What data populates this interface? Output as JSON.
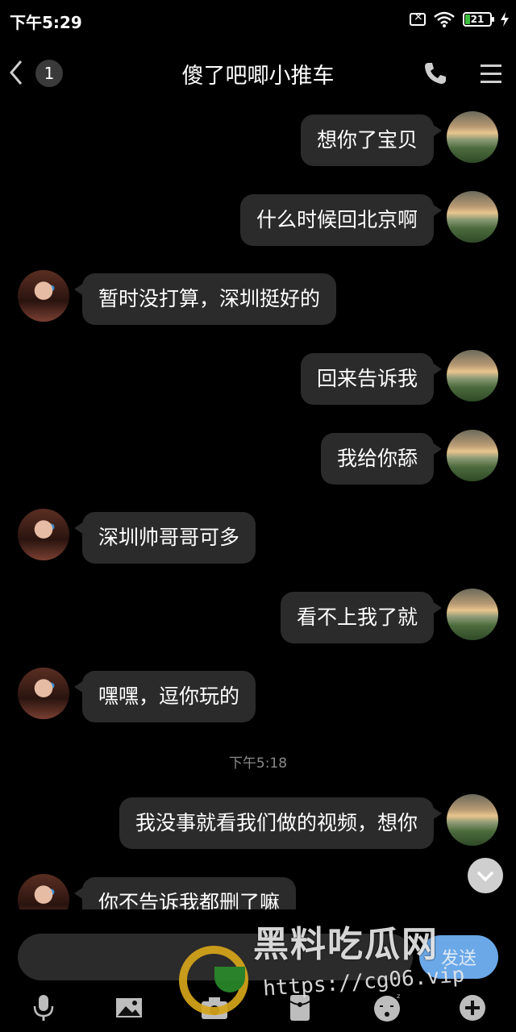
{
  "status_bar": {
    "time": "下午5:29",
    "battery": "21"
  },
  "header": {
    "unread_count": "1",
    "title": "傻了吧唧小推车"
  },
  "messages": [
    {
      "side": "me",
      "text": "想你了宝贝"
    },
    {
      "side": "me",
      "text": "什么时候回北京啊"
    },
    {
      "side": "other",
      "text": "暂时没打算，深圳挺好的"
    },
    {
      "side": "me",
      "text": "回来告诉我"
    },
    {
      "side": "me",
      "text": "我给你舔"
    },
    {
      "side": "other",
      "text": "深圳帅哥哥可多"
    },
    {
      "side": "me",
      "text": "看不上我了就"
    },
    {
      "side": "other",
      "text": "嘿嘿，逗你玩的"
    },
    {
      "timestamp": "下午5:18"
    },
    {
      "side": "me",
      "text": "我没事就看我们做的视频，想你"
    },
    {
      "side": "other",
      "text": "你不告诉我都删了嘛"
    }
  ],
  "input": {
    "placeholder": "",
    "send_label": "发送"
  },
  "toolbar": [
    "microphone-icon",
    "image-icon",
    "camera-icon",
    "red-packet-icon",
    "emoji-icon",
    "plus-icon"
  ],
  "watermark": {
    "title": "黑料吃瓜网",
    "url": "https://cg06.vip"
  },
  "colors": {
    "background": "#000000",
    "bubble": "#2b2b2b",
    "send_button": "#6aa8e8"
  }
}
